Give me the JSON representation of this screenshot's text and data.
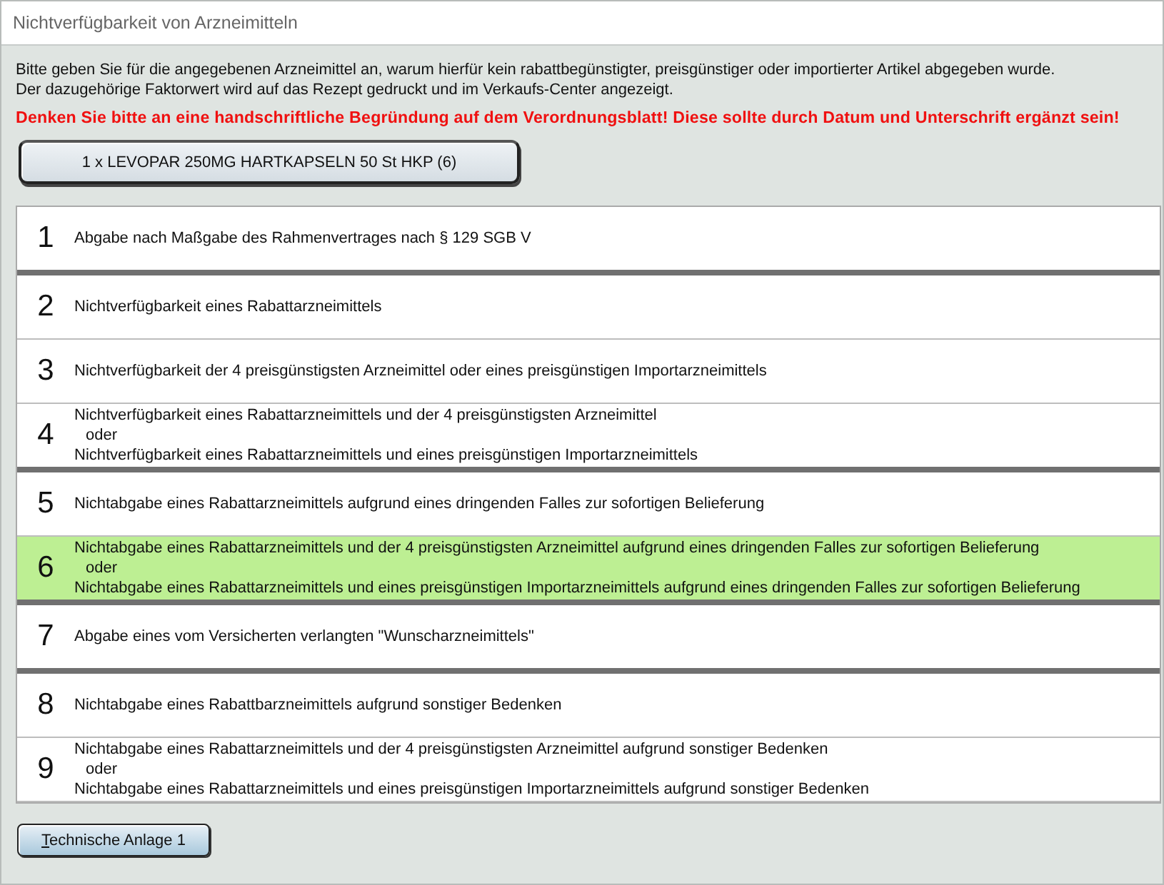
{
  "window": {
    "title": "Nichtverfügbarkeit von Arzneimitteln"
  },
  "instructions": [
    "Bitte geben Sie für die angegebenen Arzneimittel an, warum hierfür kein rabattbegünstigter, preisgünstiger oder importierter Artikel abgegeben wurde.",
    "Der dazugehörige Faktorwert wird auf das Rezept gedruckt und im Verkaufs-Center angezeigt."
  ],
  "warning": "Denken Sie bitte an eine handschriftliche Begründung auf dem Verordnungsblatt! Diese sollte durch Datum und Unterschrift ergänzt sein!",
  "article_button": "1 x LEVOPAR 250MG HARTKAPSELN 50 St HKP (6)",
  "reasons": [
    {
      "number": "1",
      "lines": [
        "Abgabe nach Maßgabe des Rahmenvertrages nach § 129 SGB V"
      ],
      "selected": false,
      "group_end": true
    },
    {
      "number": "2",
      "lines": [
        "Nichtverfügbarkeit eines Rabattarzneimittels"
      ],
      "selected": false,
      "group_end": false
    },
    {
      "number": "3",
      "lines": [
        "Nichtverfügbarkeit der 4 preisgünstigsten Arzneimittel oder eines preisgünstigen Importarzneimittels"
      ],
      "selected": false,
      "group_end": false
    },
    {
      "number": "4",
      "lines": [
        "Nichtverfügbarkeit eines Rabattarzneimittels und der 4 preisgünstigsten Arzneimittel",
        "oder",
        "Nichtverfügbarkeit eines Rabattarzneimittels und eines preisgünstigen Importarzneimittels"
      ],
      "selected": false,
      "group_end": true
    },
    {
      "number": "5",
      "lines": [
        "Nichtabgabe eines Rabattarzneimittels aufgrund eines dringenden Falles zur sofortigen Belieferung"
      ],
      "selected": false,
      "group_end": false
    },
    {
      "number": "6",
      "lines": [
        "Nichtabgabe eines Rabattarzneimittels und der 4 preisgünstigsten Arzneimittel aufgrund eines dringenden Falles zur sofortigen Belieferung",
        "oder",
        "Nichtabgabe eines Rabattarzneimittels und eines preisgünstigen Importarzneimittels aufgrund eines dringenden Falles zur sofortigen Belieferung"
      ],
      "selected": true,
      "group_end": true
    },
    {
      "number": "7",
      "lines": [
        "Abgabe eines vom Versicherten verlangten \"Wunscharzneimittels\""
      ],
      "selected": false,
      "group_end": true
    },
    {
      "number": "8",
      "lines": [
        "Nichtabgabe eines Rabattbarzneimittels aufgrund sonstiger Bedenken"
      ],
      "selected": false,
      "group_end": false
    },
    {
      "number": "9",
      "lines": [
        "Nichtabgabe eines Rabattarzneimittels und der 4 preisgünstigsten Arzneimittel aufgrund sonstiger Bedenken",
        "oder",
        "Nichtabgabe eines Rabattarzneimittels und eines preisgünstigen Importarzneimittels aufgrund sonstiger Bedenken"
      ],
      "selected": false,
      "group_end": false
    }
  ],
  "footer_button": {
    "label": "Technische Anlage 1"
  }
}
